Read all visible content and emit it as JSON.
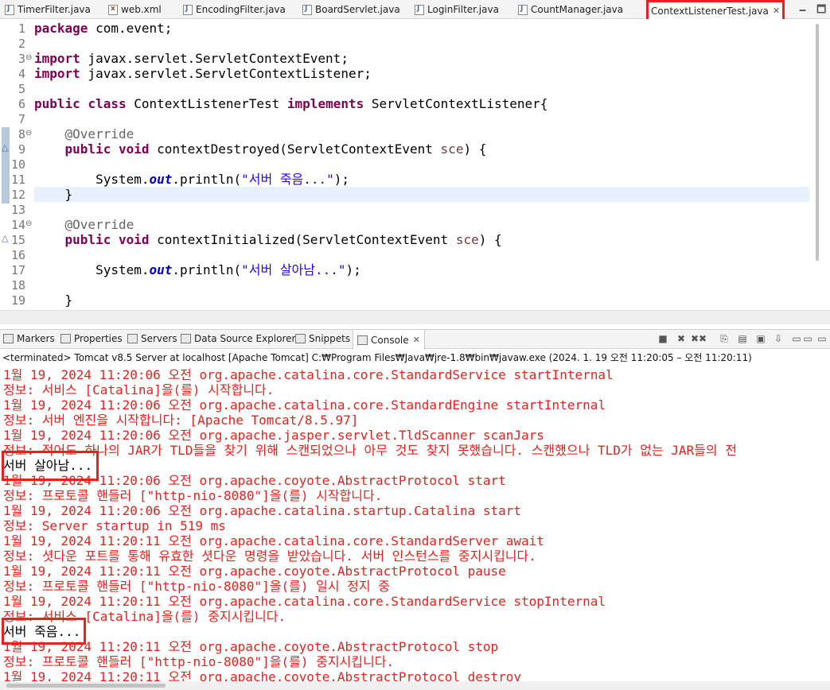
{
  "editor_tabs": [
    {
      "label": "TimerFilter.java"
    },
    {
      "label": "web.xml"
    },
    {
      "label": "EncodingFilter.java"
    },
    {
      "label": "BoardServlet.java"
    },
    {
      "label": "LoginFilter.java"
    },
    {
      "label": "CountManager.java"
    },
    {
      "label": "ContextListenerTest.java",
      "active": true,
      "close": "✕"
    }
  ],
  "window_controls": {
    "minimize": "🗕",
    "maximize": "🗖"
  },
  "code_lines": [
    {
      "n": "1"
    },
    {
      "n": "2"
    },
    {
      "n": "3"
    },
    {
      "n": "4"
    },
    {
      "n": "5"
    },
    {
      "n": "6"
    },
    {
      "n": "7"
    },
    {
      "n": "8"
    },
    {
      "n": "9"
    },
    {
      "n": "10"
    },
    {
      "n": "11"
    },
    {
      "n": "12"
    },
    {
      "n": "13"
    },
    {
      "n": "14"
    },
    {
      "n": "15"
    },
    {
      "n": "16"
    },
    {
      "n": "17"
    },
    {
      "n": "18"
    },
    {
      "n": "19"
    }
  ],
  "code": {
    "l1_kw": "package",
    "l1_rest": " com.event;",
    "l3_kw": "import",
    "l3_rest": " javax.servlet.ServletContextEvent;",
    "l4_kw": "import",
    "l4_rest": " javax.servlet.ServletContextListener;",
    "l6_kw1": "public",
    "l6_kw2": "class",
    "l6_name": " ContextListenerTest ",
    "l6_kw3": "implements",
    "l6_rest": " ServletContextListener{",
    "l8_ann": "@Override",
    "l9_kw1": "public",
    "l9_kw2": "void",
    "l9_rest": " contextDestroyed(ServletContextEvent ",
    "l9_param": "sce",
    "l9_end": ") {",
    "l11_pre": "System.",
    "l11_fld": "out",
    "l11_mid": ".println(",
    "l11_str": "\"서버 죽음...\"",
    "l11_end": ");",
    "l12": "}",
    "l14_ann": "@Override",
    "l15_kw1": "public",
    "l15_kw2": "void",
    "l15_rest": " contextInitialized(ServletContextEvent ",
    "l15_param": "sce",
    "l15_end": ") {",
    "l17_pre": "System.",
    "l17_fld": "out",
    "l17_mid": ".println(",
    "l17_str": "\"서버 살아남...\"",
    "l17_end": ");",
    "l19": "}"
  },
  "view_tabs": [
    {
      "label": "Markers"
    },
    {
      "label": "Properties"
    },
    {
      "label": "Servers"
    },
    {
      "label": "Data Source Explorer"
    },
    {
      "label": "Snippets"
    },
    {
      "label": "Console",
      "active": true,
      "close": "✕"
    }
  ],
  "console_toolbar": [
    "■",
    "✖",
    "✖✖",
    "⎘",
    "▤",
    "▣",
    "⇩",
    "▭",
    "▭",
    "▭"
  ],
  "console": {
    "description": "<terminated> Tomcat v8.5 Server at localhost [Apache Tomcat] C:₩Program Files₩Java₩jre-1.8₩bin₩javaw.exe  (2024. 1. 19 오전 11:20:05 – 오전 11:20:11)",
    "lines": [
      {
        "text": "1월 19, 2024 11:20:06 오전 org.apache.catalina.core.StandardService startInternal",
        "kind": "err"
      },
      {
        "text": "정보: 서비스 [Catalina]을(를) 시작합니다.",
        "kind": "err"
      },
      {
        "text": "1월 19, 2024 11:20:06 오전 org.apache.catalina.core.StandardEngine startInternal",
        "kind": "err"
      },
      {
        "text": "정보: 서버 엔진을 시작합니다: [Apache Tomcat/8.5.97]",
        "kind": "err"
      },
      {
        "text": "1월 19, 2024 11:20:06 오전 org.apache.jasper.servlet.TldScanner scanJars",
        "kind": "err"
      },
      {
        "text": "정보: 적어도 하나의 JAR가 TLD들을 찾기 위해 스캔되었으나 아무 것도 찾지 못했습니다. 스캔했으나 TLD가 없는 JAR들의 전",
        "kind": "err"
      },
      {
        "text": "서버 살아남...",
        "kind": "out"
      },
      {
        "text": "1월 19, 2024 11:20:06 오전 org.apache.coyote.AbstractProtocol start",
        "kind": "err"
      },
      {
        "text": "정보: 프로토콜 핸들러 [\"http-nio-8080\"]을(를) 시작합니다.",
        "kind": "err"
      },
      {
        "text": "1월 19, 2024 11:20:06 오전 org.apache.catalina.startup.Catalina start",
        "kind": "err"
      },
      {
        "text": "정보: Server startup in 519 ms",
        "kind": "err"
      },
      {
        "text": "1월 19, 2024 11:20:11 오전 org.apache.catalina.core.StandardServer await",
        "kind": "err"
      },
      {
        "text": "정보: 셧다운 포트를 통해 유효한 셧다운 명령을 받았습니다. 서버 인스턴스를 중지시킵니다.",
        "kind": "err"
      },
      {
        "text": "1월 19, 2024 11:20:11 오전 org.apache.coyote.AbstractProtocol pause",
        "kind": "err"
      },
      {
        "text": "정보: 프로토콜 핸들러 [\"http-nio-8080\"]을(를) 일시 정지 중",
        "kind": "err"
      },
      {
        "text": "1월 19, 2024 11:20:11 오전 org.apache.catalina.core.StandardService stopInternal",
        "kind": "err"
      },
      {
        "text": "정보: 서비스 [Catalina]을(를) 중지시킵니다.",
        "kind": "err"
      },
      {
        "text": "서버 죽음...",
        "kind": "out"
      },
      {
        "text": "1월 19, 2024 11:20:11 오전 org.apache.coyote.AbstractProtocol stop",
        "kind": "err"
      },
      {
        "text": "정보: 프로토콜 핸들러 [\"http-nio-8080\"]을(를) 중지시킵니다.",
        "kind": "err"
      },
      {
        "text": "1월 19, 2024 11:20:11 오전 org.apache.coyote.AbstractProtocol destroy",
        "kind": "err"
      }
    ]
  },
  "colors": {
    "console_error": "#e8211c",
    "highlight_box": "#e8211c",
    "keyword": "#7f0055",
    "string": "#2a00ff"
  }
}
